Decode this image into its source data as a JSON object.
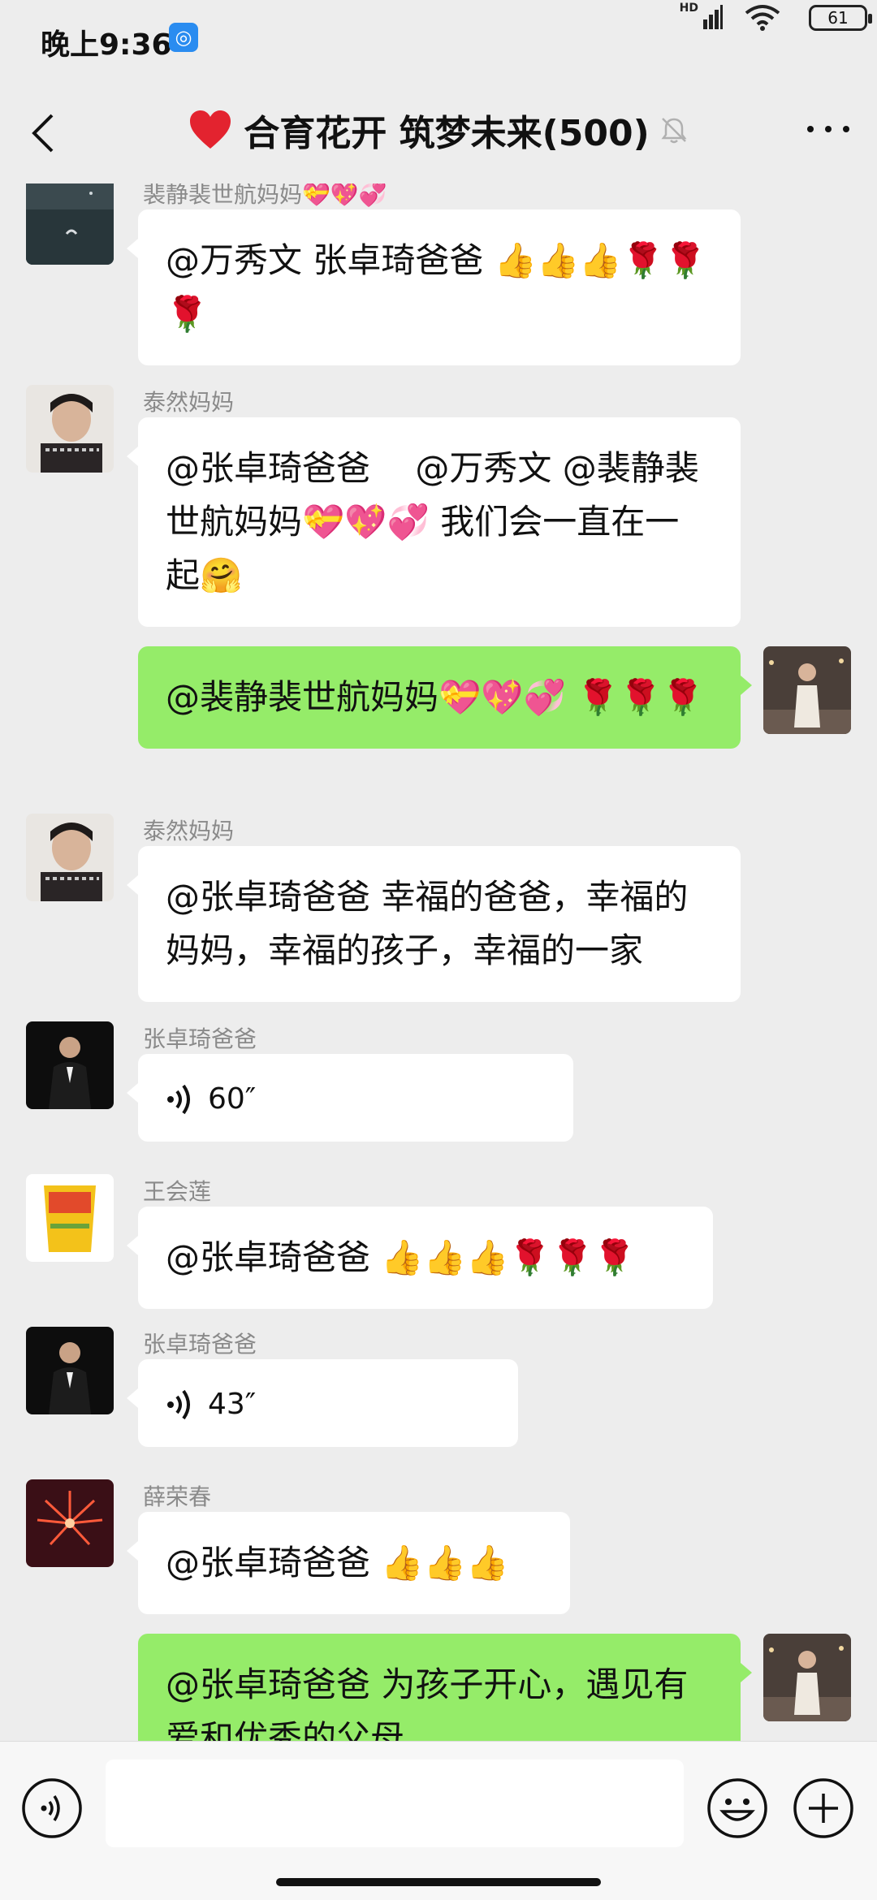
{
  "status": {
    "time": "晚上9:36",
    "network": "HD",
    "battery": "61"
  },
  "header": {
    "title": "合育花开 筑梦未来(500)"
  },
  "messages": [
    {
      "sender": "裴静裴世航妈妈💝💖💞",
      "text": "@万秀文 张卓琦爸爸 👍👍👍🌹🌹🌹",
      "side": "left"
    },
    {
      "sender": "泰然妈妈",
      "text": "@张卓琦爸爸　 @万秀文 @裴静裴世航妈妈💝💖💞 我们会一直在一起🤗",
      "side": "left"
    },
    {
      "sender": "",
      "text": "@裴静裴世航妈妈💝💖💞 🌹🌹🌹",
      "side": "right"
    },
    {
      "sender": "泰然妈妈",
      "text": "@张卓琦爸爸 幸福的爸爸，幸福的妈妈，幸福的孩子，幸福的一家",
      "side": "left"
    },
    {
      "sender": "张卓琦爸爸",
      "voice": "60″",
      "side": "left"
    },
    {
      "sender": "王会莲",
      "text": "@张卓琦爸爸 👍👍👍🌹🌹🌹",
      "side": "left"
    },
    {
      "sender": "张卓琦爸爸",
      "voice": "43″",
      "side": "left"
    },
    {
      "sender": "薛荣春",
      "text": "@张卓琦爸爸 👍👍👍",
      "side": "left"
    },
    {
      "sender": "",
      "text": "@张卓琦爸爸 为孩子开心，遇见有爱和优秀的父母",
      "side": "right"
    }
  ],
  "input": {
    "value": ""
  },
  "colors": {
    "background": "#ededed",
    "bubble_self": "#95ec69",
    "bubble_other": "#ffffff"
  }
}
